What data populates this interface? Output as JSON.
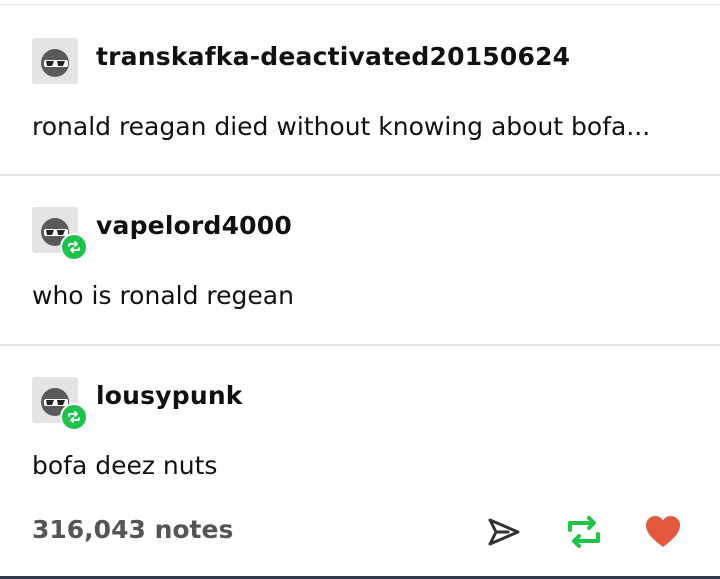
{
  "posts": [
    {
      "username": "transkafka-deactivated20150624",
      "text": "ronald reagan died without knowing about bofa...",
      "reblog": false
    },
    {
      "username": "vapelord4000",
      "text": "who is ronald regean",
      "reblog": true
    },
    {
      "username": "lousypunk",
      "text": "bofa deez nuts",
      "reblog": true
    }
  ],
  "footer": {
    "notes": "316,043 notes"
  },
  "icons": {
    "share": "paper-plane-icon",
    "reblog": "reblog-icon",
    "like": "heart-icon",
    "avatar": "sunglasses-face-icon"
  },
  "colors": {
    "reblog_green": "#1fc24b",
    "like_red": "#e2593d"
  }
}
